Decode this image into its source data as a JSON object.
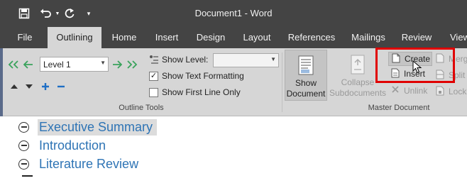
{
  "window": {
    "title": "Document1 - Word"
  },
  "quick_access": [
    {
      "name": "save-icon"
    },
    {
      "name": "undo-icon"
    },
    {
      "name": "redo-icon"
    },
    {
      "name": "customize-qat-icon"
    }
  ],
  "tabs": [
    "File",
    "Outlining",
    "Home",
    "Insert",
    "Design",
    "Layout",
    "References",
    "Mailings",
    "Review",
    "View"
  ],
  "active_tab": "Outlining",
  "outline_tools": {
    "level_value": "Level 1",
    "show_level_label": "Show Level:",
    "show_level_value": "",
    "show_text_formatting_label": "Show Text Formatting",
    "show_text_formatting_checked": true,
    "show_first_line_only_label": "Show First Line Only",
    "show_first_line_only_checked": false,
    "group_label": "Outline Tools"
  },
  "master_document": {
    "show_document_line1": "Show",
    "show_document_line2": "Document",
    "collapse_line1": "Collapse",
    "collapse_line2": "Subdocuments",
    "create_label": "Create",
    "insert_label": "Insert",
    "unlink_label": "Unlink",
    "merge_label": "Merge",
    "split_label": "Split",
    "lock_label": "Lock",
    "group_label": "Master Document"
  },
  "colors": {
    "titlebar": "#444444",
    "ribbon": "#d6d6d6",
    "heading": "#2e74b5",
    "highlight": "#e00000",
    "arrow_green": "#3aa35c",
    "arrow_blue": "#1f6fc5"
  },
  "document": {
    "headings": [
      {
        "text": "Executive Summary",
        "selected": true
      },
      {
        "text": "Introduction",
        "selected": false
      },
      {
        "text": "Literature Review",
        "selected": false
      }
    ]
  }
}
